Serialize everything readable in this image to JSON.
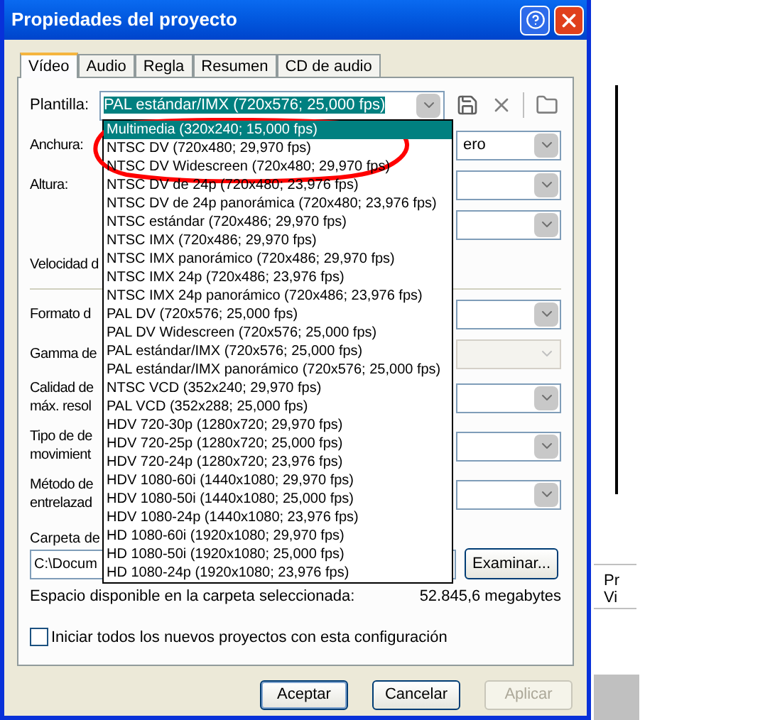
{
  "window": {
    "title": "Propiedades del proyecto"
  },
  "tabs": [
    {
      "label": "Vídeo",
      "selected": true
    },
    {
      "label": "Audio",
      "selected": false
    },
    {
      "label": "Regla",
      "selected": false
    },
    {
      "label": "Resumen",
      "selected": false
    },
    {
      "label": "CD de audio",
      "selected": false
    }
  ],
  "template": {
    "label": "Plantilla:",
    "value": "PAL estándar/IMX (720x576; 25,000 fps)"
  },
  "template_list": [
    {
      "text": "Multimedia (320x240; 15,000 fps)",
      "selected": true
    },
    {
      "text": "NTSC DV (720x480; 29,970 fps)",
      "selected": false
    },
    {
      "text": "NTSC DV Widescreen (720x480; 29,970 fps)",
      "selected": false
    },
    {
      "text": "NTSC DV de 24p (720x480; 23,976 fps)",
      "selected": false
    },
    {
      "text": "NTSC DV de 24p panorámica (720x480; 23,976 fps)",
      "selected": false
    },
    {
      "text": "NTSC estándar (720x486; 29,970 fps)",
      "selected": false
    },
    {
      "text": "NTSC IMX (720x486; 29,970 fps)",
      "selected": false
    },
    {
      "text": "NTSC IMX panorámico (720x486; 29,970 fps)",
      "selected": false
    },
    {
      "text": "NTSC IMX 24p (720x486; 23,976 fps)",
      "selected": false
    },
    {
      "text": "NTSC IMX 24p panorámico (720x486; 23,976 fps)",
      "selected": false
    },
    {
      "text": "PAL DV (720x576; 25,000 fps)",
      "selected": false
    },
    {
      "text": "PAL DV Widescreen (720x576; 25,000 fps)",
      "selected": false
    },
    {
      "text": "PAL estándar/IMX (720x576; 25,000 fps)",
      "selected": false
    },
    {
      "text": "PAL estándar/IMX panorámico (720x576; 25,000 fps)",
      "selected": false
    },
    {
      "text": "NTSC VCD (352x240; 29,970 fps)",
      "selected": false
    },
    {
      "text": "PAL VCD (352x288; 25,000 fps)",
      "selected": false
    },
    {
      "text": "HDV 720-30p (1280x720; 29,970 fps)",
      "selected": false
    },
    {
      "text": "HDV 720-25p (1280x720; 25,000 fps)",
      "selected": false
    },
    {
      "text": "HDV 720-24p (1280x720; 23,976 fps)",
      "selected": false
    },
    {
      "text": "HDV 1080-60i (1440x1080; 29,970 fps)",
      "selected": false
    },
    {
      "text": "HDV 1080-50i (1440x1080; 25,000 fps)",
      "selected": false
    },
    {
      "text": "HDV 1080-24p (1440x1080; 23,976 fps)",
      "selected": false
    },
    {
      "text": "HD 1080-60i (1920x1080; 29,970 fps)",
      "selected": false
    },
    {
      "text": "HD 1080-50i (1920x1080; 25,000 fps)",
      "selected": false
    },
    {
      "text": "HD 1080-24p (1920x1080; 23,976 fps)",
      "selected": false
    }
  ],
  "group_1": [
    {
      "kind": "combo",
      "lines": [
        "Anchura:"
      ],
      "value": "ero",
      "disabled": false
    },
    {
      "kind": "combo",
      "lines": [
        "Altura:"
      ],
      "disabled": false
    },
    {
      "kind": "combo",
      "disabled": false
    },
    {
      "kind": "label",
      "lines": [
        "Velocidad d"
      ]
    }
  ],
  "group_2": [
    {
      "kind": "combo",
      "lines": [
        "Formato d"
      ],
      "disabled": false
    },
    {
      "kind": "combo",
      "lines": [
        "Gamma de"
      ],
      "disabled": true
    },
    {
      "kind": "combo",
      "lines": [
        "Calidad de",
        "máx. resol"
      ],
      "disabled": false
    },
    {
      "kind": "combo",
      "lines": [
        "Tipo de de",
        "movimient"
      ],
      "disabled": false
    },
    {
      "kind": "combo",
      "lines": [
        "Método de",
        "entrelazad"
      ],
      "disabled": false
    }
  ],
  "folder": {
    "label": "Carpeta de",
    "value": "C:\\Docum",
    "browse": "Examinar...",
    "space_label": "Espacio disponible en la carpeta seleccionada:",
    "space_value": "52.845,6 megabytes"
  },
  "apply_all": {
    "label": "Iniciar todos los nuevos proyectos con esta configuración",
    "checked": false
  },
  "buttons": [
    {
      "label": "Aceptar",
      "default": true,
      "disabled": false
    },
    {
      "label": "Cancelar",
      "default": false,
      "disabled": false
    },
    {
      "label": "Aplicar",
      "default": false,
      "disabled": true
    }
  ],
  "background_window": {
    "texts": [
      "Pr",
      "Vi"
    ]
  }
}
